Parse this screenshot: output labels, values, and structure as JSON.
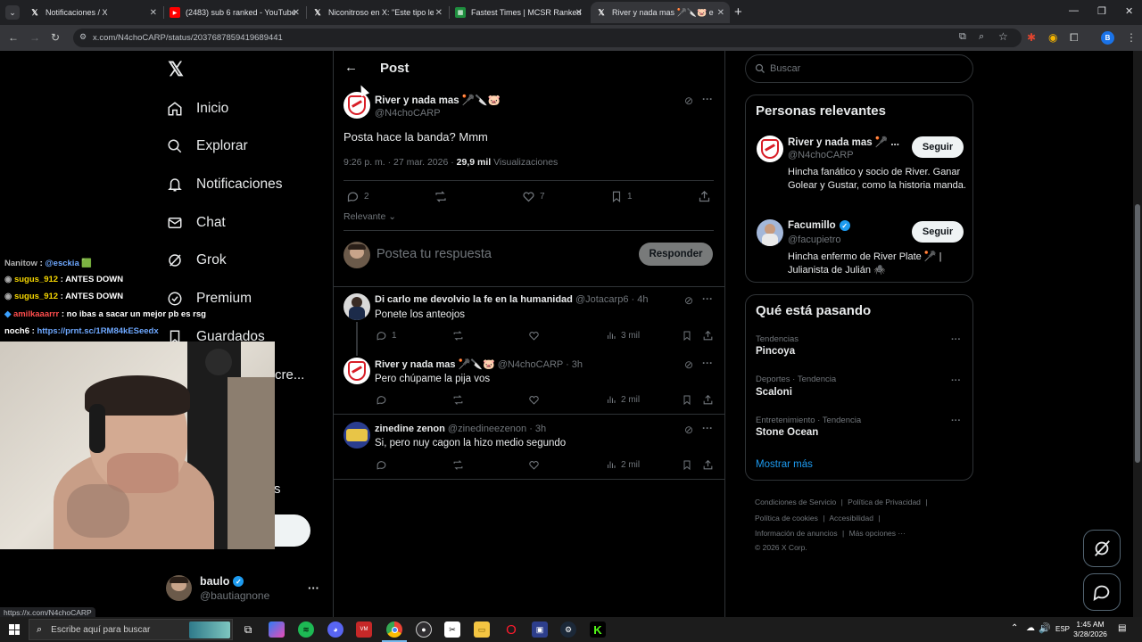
{
  "browser": {
    "tabs": [
      {
        "title": "Notificaciones / X"
      },
      {
        "title": "(2483) sub 6 ranked - YouTube"
      },
      {
        "title": "Niconitroso en X: \"Este tipo le c"
      },
      {
        "title": "Fastest Times | MCSR Ranked"
      },
      {
        "title": "River y nada mas 🥍🔪🐷 en X"
      }
    ],
    "url": "x.com/N4choCARP/status/2037687859419689441",
    "status_url": "https://x.com/N4choCARP",
    "profile_initial": "B"
  },
  "nav": {
    "items": [
      {
        "label": "Inicio"
      },
      {
        "label": "Explorar"
      },
      {
        "label": "Notificaciones"
      },
      {
        "label": "Chat"
      },
      {
        "label": "Grok"
      },
      {
        "label": "Premium"
      },
      {
        "label": "Guardados"
      }
    ],
    "partial_label": "cre...",
    "partial_label2": "s",
    "account": {
      "name": "baulo",
      "handle": "@bautiagnone"
    }
  },
  "post": {
    "header_title": "Post",
    "author_name": "River y nada mas 🥍🔪🐷",
    "author_handle": "@N4choCARP",
    "text": "Posta hace la banda? Mmm",
    "time": "9:26 p. m. · 27 mar. 2026 ·",
    "views_count": "29,9 mil",
    "views_label": "Visualizaciones",
    "replies": "2",
    "likes": "7",
    "bookmarks": "1",
    "sort_label": "Relevante",
    "reply_placeholder": "Postea tu respuesta",
    "reply_button": "Responder"
  },
  "replies": [
    {
      "name": "Di carlo me devolvio la fe en la humanidad",
      "handle": "@Jotacarp6 · 4h",
      "text": "Ponete los anteojos",
      "replies": "1",
      "views": "3 mil"
    },
    {
      "name": "River y nada mas 🥍🔪🐷",
      "handle": "@N4choCARP · 3h",
      "text": "Pero chúpame la pija vos",
      "replies": "",
      "views": "2 mil"
    },
    {
      "name": "zinedine zenon",
      "handle": "@zinedineezenon · 3h",
      "text": "Si, pero nuy cagon la hizo medio segundo",
      "replies": "",
      "views": "2 mil"
    }
  ],
  "sidebar": {
    "search_placeholder": "Buscar",
    "relevant_title": "Personas relevantes",
    "people": [
      {
        "name": "River y nada mas 🥍 ...",
        "handle": "@N4choCARP",
        "bio": "Hincha fanático y socio de River. Ganar Golear y Gustar, como la historia manda.",
        "button": "Seguir"
      },
      {
        "name": "Facumillo",
        "handle": "@facupietro",
        "bio": "Hincha enfermo de River Plate 🥍 | Julianista de Julián 🕷️",
        "button": "Seguir"
      }
    ],
    "trends_title": "Qué está pasando",
    "trends": [
      {
        "context": "Tendencias",
        "name": "Pincoya"
      },
      {
        "context": "Deportes · Tendencia",
        "name": "Scaloni"
      },
      {
        "context": "Entretenimiento · Tendencia",
        "name": "Stone Ocean"
      }
    ],
    "show_more": "Mostrar más",
    "footer": {
      "links1": [
        "Condiciones de Servicio",
        "Política de Privacidad"
      ],
      "links2": [
        "Política de cookies",
        "Accesibilidad"
      ],
      "links3": [
        "Información de anuncios",
        "Más opciones ···"
      ],
      "copyright": "© 2026 X Corp."
    }
  },
  "chat": [
    {
      "user": "Nanitow",
      "msg": "@esckia 🟩",
      "color": "#b2b2b2"
    },
    {
      "user": "sugus_912",
      "msg": "ANTES DOWN",
      "color": "#f5d600"
    },
    {
      "user": "sugus_912",
      "msg": "ANTES DOWN",
      "color": "#f5d600"
    },
    {
      "user": "amilkaaarrr",
      "msg": "no ibas a sacar un mejor pb es rsg",
      "color": "#ff4d4d"
    },
    {
      "user": "noch6",
      "msg": "https://prnt.sc/1RM84kESeedx",
      "color": "#ffffff"
    }
  ],
  "taskbar": {
    "search_placeholder": "Escribe aquí para buscar",
    "time": "1:45 AM",
    "date": "3/28/2026",
    "lang": "ESP"
  },
  "colors": {
    "accent": "#1d9bf0",
    "background": "#000000",
    "border": "#2f3336",
    "muted": "#71767b"
  }
}
